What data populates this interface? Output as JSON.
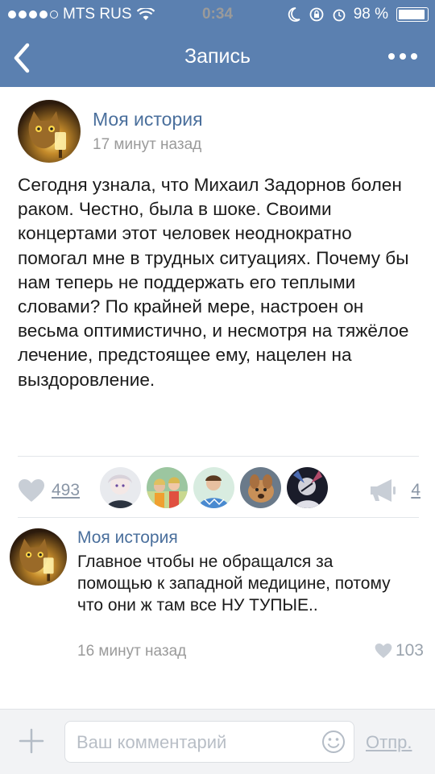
{
  "status_bar": {
    "carrier": "MTS RUS",
    "time": "0:34",
    "battery": "98 %"
  },
  "nav": {
    "title": "Запись",
    "back_icon": "chevron-left-icon",
    "more_icon": "more-dots-icon"
  },
  "post": {
    "author": "Моя история",
    "time": "17 минут назад",
    "text": "Сегодня узнала, что Михаил Задорнов болен раком. Честно, была в шоке. Своими концертами этот человек неоднократно помогал мне в трудных ситуациях. Почему бы нам теперь не поддержать его теплыми словами? По крайней мере, настроен он весьма оптимистично, и несмотря на тяжёлое лечение, предстоящее ему, нацелен на выздоровление.",
    "likes": "493",
    "shares": "4"
  },
  "comment": {
    "author": "Моя история",
    "text": "Главное чтобы не обращался за помощью к западной медицине, потому что они ж там все НУ ТУПЫЕ..",
    "time": "16 минут назад",
    "likes": "103"
  },
  "composer": {
    "placeholder": "Ваш комментарий",
    "send_label": "Отпр."
  },
  "colors": {
    "header": "#5b80b0",
    "link": "#4a6f9c",
    "muted": "#9a9a9a"
  }
}
